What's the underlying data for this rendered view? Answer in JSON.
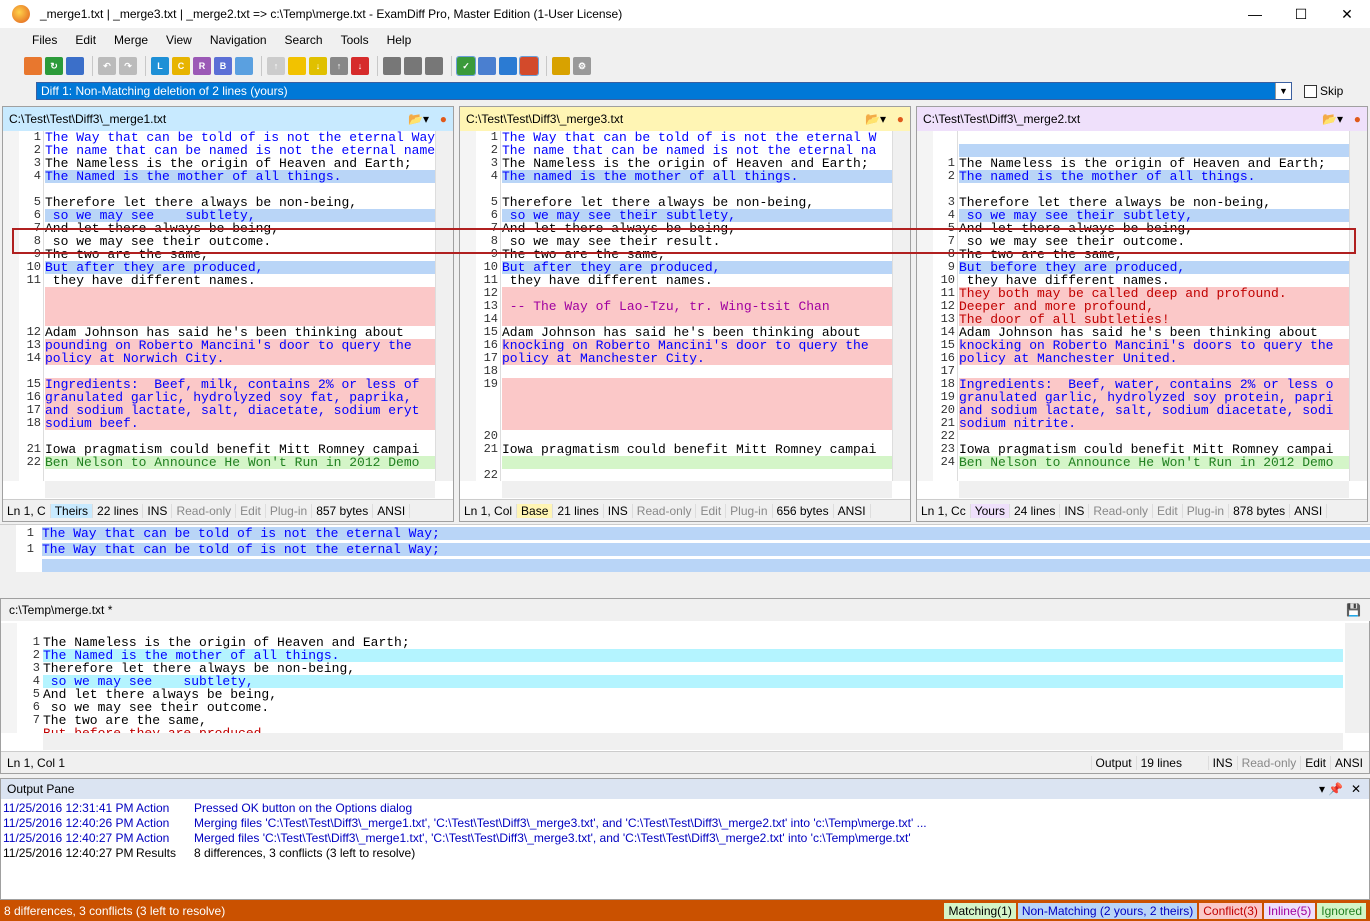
{
  "window": {
    "title": "_merge1.txt  |  _merge3.txt  |  _merge2.txt  =>  c:\\Temp\\merge.txt - ExamDiff Pro, Master Edition (1-User License)"
  },
  "menu": [
    "Files",
    "Edit",
    "Merge",
    "View",
    "Navigation",
    "Search",
    "Tools",
    "Help"
  ],
  "diffnav": {
    "current": "Diff 1: Non-Matching deletion of 2 lines (yours)",
    "skip_label": "Skip"
  },
  "panes": [
    {
      "path": "C:\\Test\\Test\\Diff3\\_merge1.txt",
      "status": {
        "pos": "Ln 1, C",
        "role": "Theirs",
        "lines": "22 lines",
        "ins": "INS",
        "ro": "Read-only",
        "edit": "Edit",
        "plugin": "Plug-in",
        "bytes": "857 bytes",
        "enc": "ANSI"
      },
      "rows": [
        {
          "n": "1",
          "t": "The Way that can be told of is not the eternal Way;",
          "c": "blue"
        },
        {
          "n": "2",
          "t": "The name that can be named is not the eternal name.",
          "c": "blue"
        },
        {
          "n": "3",
          "t": "The Nameless is the origin of Heaven and Earth;",
          "c": ""
        },
        {
          "n": "4",
          "t": "The Named is the mother of all things.",
          "c": "bluebg"
        },
        {
          "n": "",
          "t": "",
          "c": ""
        },
        {
          "n": "5",
          "t": "Therefore let there always be non-being,",
          "c": ""
        },
        {
          "n": "6",
          "t": " so we may see    subtlety,",
          "c": "bluebg"
        },
        {
          "n": "7",
          "t": "And let there always be being,",
          "c": ""
        },
        {
          "n": "8",
          "t": " so we may see their outcome.",
          "c": "green"
        },
        {
          "n": "9",
          "t": "The two are the same,",
          "c": ""
        },
        {
          "n": "10",
          "t": "But after they are produced,",
          "c": "bluebg"
        },
        {
          "n": "11",
          "t": " they have different names.",
          "c": ""
        },
        {
          "n": "",
          "t": "",
          "c": "pink"
        },
        {
          "n": "",
          "t": "",
          "c": "pink"
        },
        {
          "n": "",
          "t": "",
          "c": "pink"
        },
        {
          "n": "12",
          "t": "Adam Johnson has said he's been thinking about",
          "c": ""
        },
        {
          "n": "13",
          "t": "pounding on Roberto Mancini's door to query the",
          "c": "pink"
        },
        {
          "n": "14",
          "t": "policy at Norwich City.",
          "c": "pink"
        },
        {
          "n": "",
          "t": "",
          "c": ""
        },
        {
          "n": "15",
          "t": "Ingredients:  Beef, milk, contains 2% or less of",
          "c": "pink"
        },
        {
          "n": "16",
          "t": "granulated garlic, hydrolyzed soy fat, paprika,",
          "c": "pink"
        },
        {
          "n": "17",
          "t": "and sodium lactate, salt, diacetate, sodium eryt",
          "c": "pink"
        },
        {
          "n": "18",
          "t": "sodium beef.",
          "c": "pink"
        },
        {
          "n": "",
          "t": "",
          "c": ""
        },
        {
          "n": "21",
          "t": "Iowa pragmatism could benefit Mitt Romney campai",
          "c": ""
        },
        {
          "n": "22",
          "t": "Ben Nelson to Announce He Won't Run in 2012 Demo",
          "c": "greenbg"
        }
      ]
    },
    {
      "path": "C:\\Test\\Test\\Diff3\\_merge3.txt",
      "status": {
        "pos": "Ln 1, Col",
        "role": "Base",
        "lines": "21 lines",
        "ins": "INS",
        "ro": "Read-only",
        "edit": "Edit",
        "plugin": "Plug-in",
        "bytes": "656 bytes",
        "enc": "ANSI"
      },
      "rows": [
        {
          "n": "1",
          "t": "The Way that can be told of is not the eternal W",
          "c": "blue"
        },
        {
          "n": "2",
          "t": "The name that can be named is not the eternal na",
          "c": "blue"
        },
        {
          "n": "3",
          "t": "The Nameless is the origin of Heaven and Earth;",
          "c": ""
        },
        {
          "n": "4",
          "t": "The named is the mother of all things.",
          "c": "bluebg"
        },
        {
          "n": "",
          "t": "",
          "c": ""
        },
        {
          "n": "5",
          "t": "Therefore let there always be non-being,",
          "c": ""
        },
        {
          "n": "6",
          "t": " so we may see their subtlety,",
          "c": "bluebg"
        },
        {
          "n": "7",
          "t": "And let there always be being,",
          "c": ""
        },
        {
          "n": "8",
          "t": " so we may see their result.",
          "c": "green"
        },
        {
          "n": "9",
          "t": "The two are the same,",
          "c": ""
        },
        {
          "n": "10",
          "t": "But after they are produced,",
          "c": "bluebg"
        },
        {
          "n": "11",
          "t": " they have different names.",
          "c": ""
        },
        {
          "n": "12",
          "t": "",
          "c": "pink"
        },
        {
          "n": "13",
          "t": " -- The Way of Lao-Tzu, tr. Wing-tsit Chan",
          "c": "pinkmg"
        },
        {
          "n": "14",
          "t": "",
          "c": "pink"
        },
        {
          "n": "15",
          "t": "Adam Johnson has said he's been thinking about",
          "c": ""
        },
        {
          "n": "16",
          "t": "knocking on Roberto Mancini's door to query the",
          "c": "pink"
        },
        {
          "n": "17",
          "t": "policy at Manchester City.",
          "c": "pink"
        },
        {
          "n": "18",
          "t": "",
          "c": ""
        },
        {
          "n": "19",
          "t": "",
          "c": "pink"
        },
        {
          "n": "",
          "t": "",
          "c": "pink"
        },
        {
          "n": "",
          "t": "",
          "c": "pink"
        },
        {
          "n": "",
          "t": "",
          "c": "pink"
        },
        {
          "n": "20",
          "t": "",
          "c": ""
        },
        {
          "n": "21",
          "t": "Iowa pragmatism could benefit Mitt Romney campai",
          "c": ""
        },
        {
          "n": "",
          "t": "",
          "c": "greenbg"
        },
        {
          "n": "22",
          "t": "",
          "c": ""
        }
      ]
    },
    {
      "path": "C:\\Test\\Test\\Diff3\\_merge2.txt",
      "status": {
        "pos": "Ln 1, Cc",
        "role": "Yours",
        "lines": "24 lines",
        "ins": "INS",
        "ro": "Read-only",
        "edit": "Edit",
        "plugin": "Plug-in",
        "bytes": "878 bytes",
        "enc": "ANSI"
      },
      "rows": [
        {
          "n": "",
          "t": "",
          "c": ""
        },
        {
          "n": "",
          "t": "",
          "c": "bluebg"
        },
        {
          "n": "1",
          "t": "The Nameless is the origin of Heaven and Earth;",
          "c": ""
        },
        {
          "n": "2",
          "t": "The named is the mother of all things.",
          "c": "bluebg"
        },
        {
          "n": "",
          "t": "",
          "c": ""
        },
        {
          "n": "3",
          "t": "Therefore let there always be non-being,",
          "c": ""
        },
        {
          "n": "4",
          "t": " so we may see their subtlety,",
          "c": "bluebg"
        },
        {
          "n": "5",
          "t": "And let there always be being,",
          "c": ""
        },
        {
          "n": "7",
          "t": " so we may see their outcome.",
          "c": "green"
        },
        {
          "n": "8",
          "t": "The two are the same,",
          "c": ""
        },
        {
          "n": "9",
          "t": "But before they are produced,",
          "c": "bluebg"
        },
        {
          "n": "10",
          "t": " they have different names.",
          "c": ""
        },
        {
          "n": "11",
          "t": "They both may be called deep and profound.",
          "c": "pinkred"
        },
        {
          "n": "12",
          "t": "Deeper and more profound,",
          "c": "pinkred"
        },
        {
          "n": "13",
          "t": "The door of all subtleties!",
          "c": "pinkred"
        },
        {
          "n": "14",
          "t": "Adam Johnson has said he's been thinking about",
          "c": ""
        },
        {
          "n": "15",
          "t": "knocking on Roberto Mancini's doors to query the",
          "c": "pink"
        },
        {
          "n": "16",
          "t": "policy at Manchester United.",
          "c": "pink"
        },
        {
          "n": "17",
          "t": "",
          "c": ""
        },
        {
          "n": "18",
          "t": "Ingredients:  Beef, water, contains 2% or less o",
          "c": "pink"
        },
        {
          "n": "19",
          "t": "granulated garlic, hydrolyzed soy protein, papri",
          "c": "pink"
        },
        {
          "n": "20",
          "t": "and sodium lactate, salt, sodium diacetate, sodi",
          "c": "pink"
        },
        {
          "n": "21",
          "t": "sodium nitrite.",
          "c": "pink"
        },
        {
          "n": "22",
          "t": "",
          "c": ""
        },
        {
          "n": "23",
          "t": "Iowa pragmatism could benefit Mitt Romney campai",
          "c": ""
        },
        {
          "n": "24",
          "t": "Ben Nelson to Announce He Won't Run in 2012 Demo",
          "c": "greenbg"
        }
      ]
    }
  ],
  "compare": {
    "rows": [
      {
        "n": "1",
        "t": "The Way that can be told of is not the eternal Way;"
      },
      {
        "n": "1",
        "t": "The Way that can be told of is not the eternal Way;"
      }
    ]
  },
  "output_file": {
    "path": "c:\\Temp\\merge.txt *",
    "rows": [
      {
        "n": "",
        "t": "",
        "c": ""
      },
      {
        "n": "1",
        "t": "The Nameless is the origin of Heaven and Earth;",
        "c": ""
      },
      {
        "n": "2",
        "t": "The Named is the mother of all things.",
        "c": "cyan"
      },
      {
        "n": "3",
        "t": "Therefore let there always be non-being,",
        "c": ""
      },
      {
        "n": "4",
        "t": " so we may see    subtlety,",
        "c": "cyan"
      },
      {
        "n": "5",
        "t": "And let there always be being,",
        "c": ""
      },
      {
        "n": "6",
        "t": " so we may see their outcome.",
        "c": ""
      },
      {
        "n": "7",
        "t": "The two are the same,",
        "c": ""
      },
      {
        "n": "",
        "t": "But before they are produced",
        "c": "cut"
      }
    ],
    "status": {
      "pos": "Ln 1, Col 1",
      "role": "Output",
      "lines": "19 lines",
      "ins": "INS",
      "ro": "Read-only",
      "edit": "Edit",
      "enc": "ANSI"
    }
  },
  "output_pane": {
    "title": "Output Pane",
    "rows": [
      {
        "time": "11/25/2016 12:31:41 PM",
        "type": "Action",
        "msg": "Pressed OK button on the Options dialog"
      },
      {
        "time": "11/25/2016 12:40:26 PM",
        "type": "Action",
        "msg": "Merging files 'C:\\Test\\Test\\Diff3\\_merge1.txt', 'C:\\Test\\Test\\Diff3\\_merge3.txt', and 'C:\\Test\\Test\\Diff3\\_merge2.txt' into 'c:\\Temp\\merge.txt' ..."
      },
      {
        "time": "11/25/2016 12:40:27 PM",
        "type": "Action",
        "msg": "Merged files 'C:\\Test\\Test\\Diff3\\_merge1.txt', 'C:\\Test\\Test\\Diff3\\_merge3.txt', and 'C:\\Test\\Test\\Diff3\\_merge2.txt' into 'c:\\Temp\\merge.txt'"
      },
      {
        "time": "11/25/2016 12:40:27 PM",
        "type": "Results",
        "msg": "8 differences, 3 conflicts (3 left to resolve)"
      }
    ]
  },
  "statusbar": {
    "text": "8 differences, 3 conflicts (3 left to resolve)",
    "matching": "Matching(1)",
    "nonmatching": "Non-Matching (2 yours, 2 theirs)",
    "conflict": "Conflict(3)",
    "inline": "Inline(5)",
    "ignored": "Ignored"
  },
  "colors": {
    "accent": "#0078d7",
    "status_bar": "#ca5100",
    "theirs": "#c8eaff",
    "base": "#fff5b4",
    "yours": "#efe0fb"
  }
}
